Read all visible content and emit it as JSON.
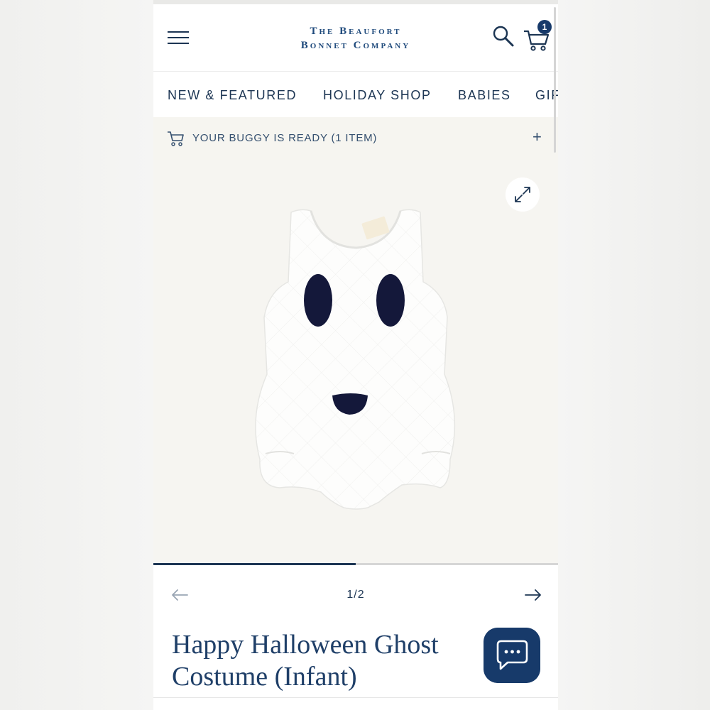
{
  "colors": {
    "brand_navy": "#173a6a",
    "text_navy": "#1c3553",
    "buggy_bg": "#f6f5f0",
    "gallery_bg": "#f6f5f1"
  },
  "header": {
    "logo_line1": "The Beaufort",
    "logo_line2": "Bonnet Company",
    "menu_icon": "hamburger-icon",
    "search_icon": "search-icon",
    "cart_icon": "cart-icon",
    "cart_count": "1"
  },
  "nav": {
    "items": [
      {
        "label": "NEW & FEATURED"
      },
      {
        "label": "HOLIDAY SHOP"
      },
      {
        "label": "BABIES"
      },
      {
        "label": "GIF"
      }
    ]
  },
  "buggy": {
    "icon": "stroller-icon",
    "text": "YOUR BUGGY IS READY (1 ITEM)",
    "expand_label": "+"
  },
  "gallery": {
    "expand_icon": "expand-icon",
    "image_subject": "white ghost romper",
    "progress": 0.5
  },
  "pager": {
    "current": "1/2",
    "prev_icon": "arrow-left-icon",
    "next_icon": "arrow-right-icon"
  },
  "product": {
    "title_line1": "Happy Halloween Ghost",
    "title_line2": "Costume (Infant)"
  },
  "chat": {
    "icon": "chat-bubble-icon"
  }
}
